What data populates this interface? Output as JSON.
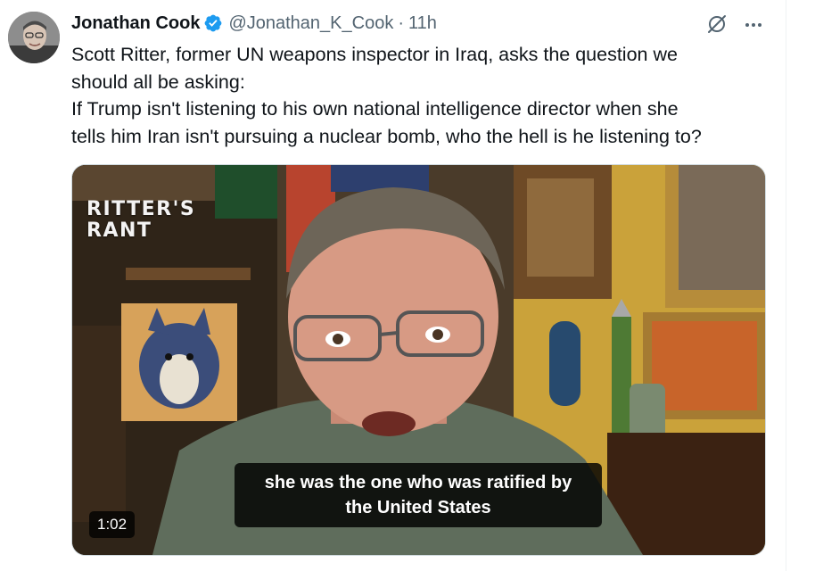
{
  "tweet": {
    "author_name": "Jonathan Cook",
    "handle": "@Jonathan_K_Cook",
    "separator": "·",
    "time": "11h",
    "text_lines": [
      "Scott Ritter, former UN weapons inspector in Iraq, asks the question we",
      "should all be asking:",
      "If Trump isn't listening to his own national intelligence director when she",
      "tells him Iran isn't pursuing a nuclear bomb, who the hell is he listening to?"
    ]
  },
  "video": {
    "brand_line1": "RITTER'S",
    "brand_line2": "RANT",
    "caption_line1": "she was the one who was ratified by",
    "caption_line2": "the United States",
    "duration": "1:02"
  },
  "icons": {
    "verified": "verified-badge-icon",
    "grok": "grok-icon",
    "more": "more-options-icon"
  },
  "colors": {
    "verified_blue": "#1d9bf0",
    "secondary_text": "#536471",
    "primary_text": "#0f1419"
  }
}
